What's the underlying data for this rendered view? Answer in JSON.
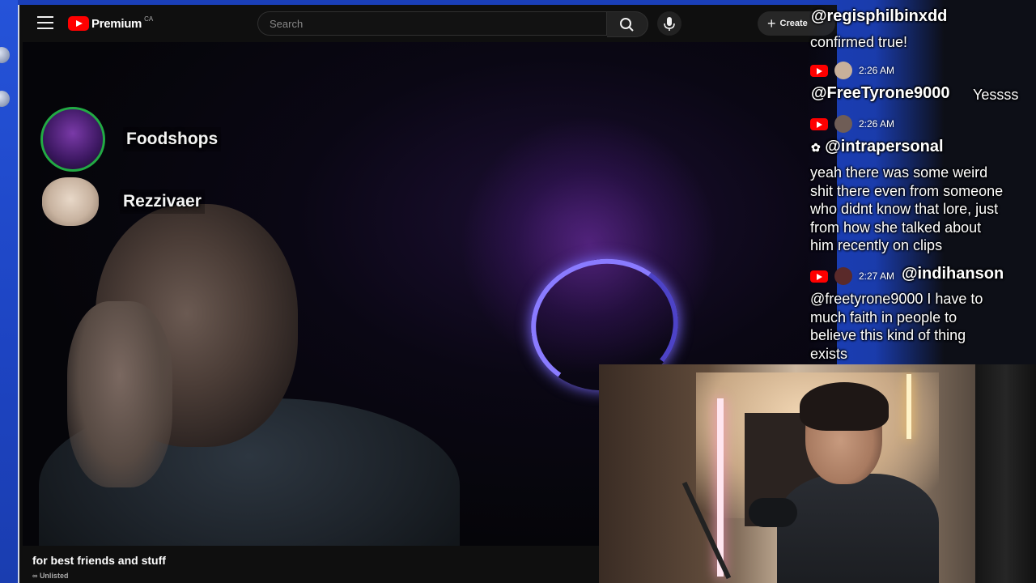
{
  "window": {
    "app": "YouTube",
    "logo_text": "Premium",
    "logo_region": "CA",
    "search": {
      "placeholder": "Search"
    },
    "create_label": "Create"
  },
  "call": {
    "participants": [
      {
        "name": "Foodshops"
      },
      {
        "name": "Rezzivaer"
      }
    ]
  },
  "video": {
    "title": "for best friends and stuff",
    "visibility": "Unlisted"
  },
  "chat": {
    "messages": [
      {
        "user": "@regisphilbinxdd",
        "text": "confirmed true!"
      },
      {
        "time": "2:26 AM",
        "user": "@FreeTyrone9000",
        "text": "Yessss"
      },
      {
        "time": "2:26 AM",
        "user": "@intrapersonal",
        "lines": [
          "yeah there was some weird",
          "shit there even from someone",
          "who didnt know that lore, just",
          "from how she talked about",
          "him recently on clips"
        ]
      },
      {
        "time": "2:27 AM",
        "user": "@indihanson",
        "lines": [
          "@freetyrone9000 I have to",
          "much faith in people to",
          "believe this kind of thing",
          "exists"
        ]
      }
    ]
  },
  "colors": {
    "accent": "#ff0000",
    "desktop": "#1a3fb8",
    "speaker_ring": "#22aa44"
  },
  "icons": [
    "menu-icon",
    "youtube-logo-icon",
    "search-icon",
    "mic-icon",
    "plus-icon",
    "link-icon",
    "youtube-badge-icon"
  ]
}
